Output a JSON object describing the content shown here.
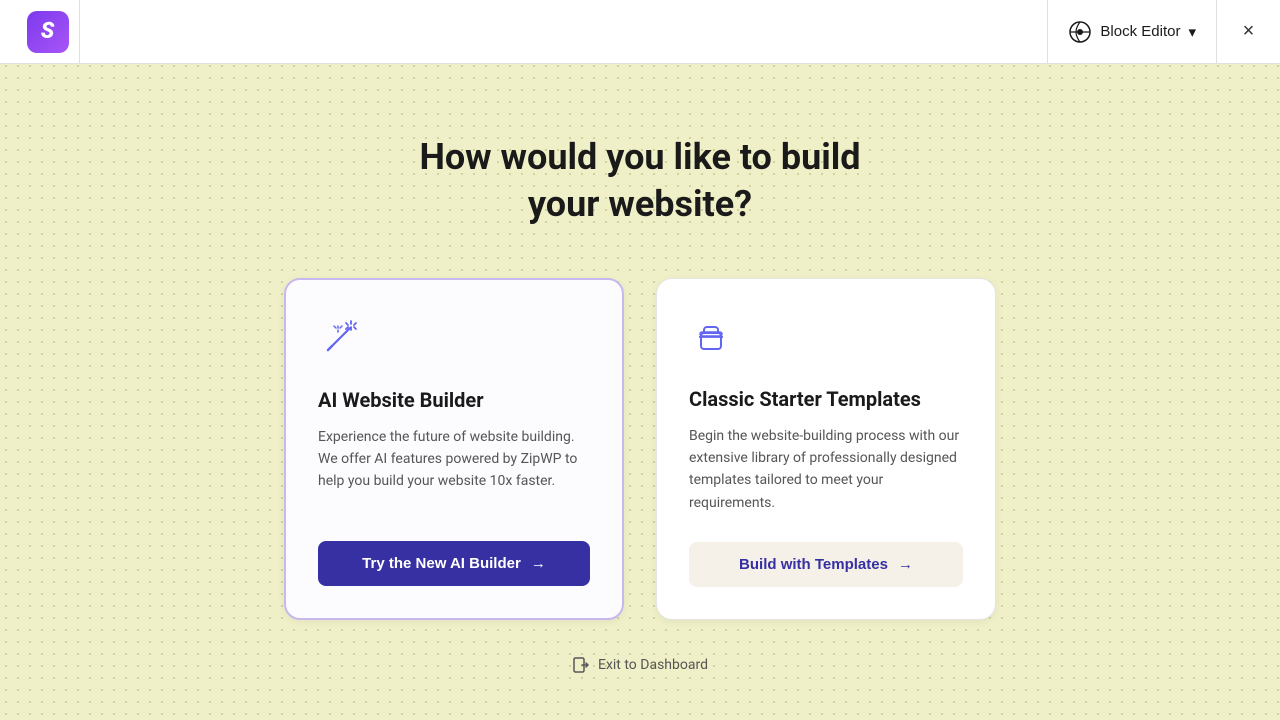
{
  "header": {
    "logo_letter": "S",
    "block_editor_label": "Block Editor",
    "chevron_icon": "chevron-down",
    "close_icon": "×"
  },
  "main": {
    "headline_line1": "How would you like to build",
    "headline_line2": "your website?"
  },
  "cards": [
    {
      "id": "ai-builder",
      "title": "AI Website Builder",
      "description": "Experience the future of website building. We offer AI features powered by ZipWP to help you build your website 10x faster.",
      "button_label": "Try the New AI Builder",
      "button_arrow": "→"
    },
    {
      "id": "classic-templates",
      "title": "Classic Starter Templates",
      "description": "Begin the website-building process with our extensive library of professionally designed templates tailored to meet your requirements.",
      "button_label": "Build with Templates",
      "button_arrow": "→"
    }
  ],
  "footer": {
    "exit_label": "Exit to Dashboard",
    "exit_icon": "exit-icon"
  }
}
